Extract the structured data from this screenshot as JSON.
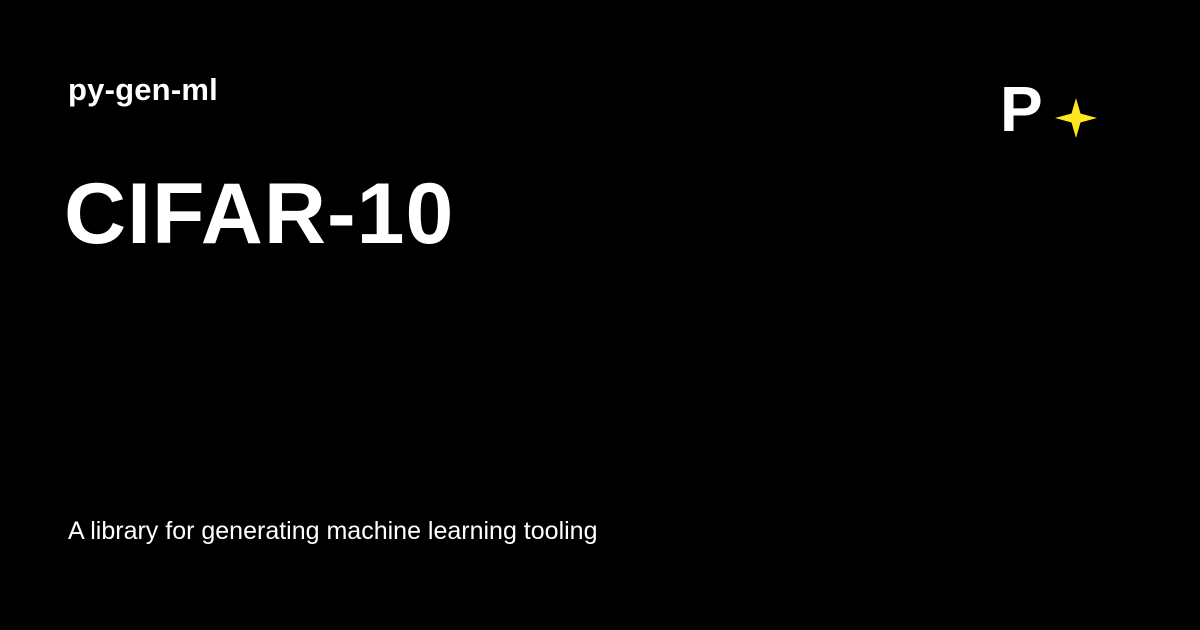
{
  "card": {
    "project_name": "py-gen-ml",
    "title": "CIFAR-10",
    "description": "A library for generating machine learning tooling",
    "logo": {
      "letter": "P",
      "icon": "sparkle-icon",
      "letter_color": "#ffffff",
      "sparkle_color": "#ffe51f"
    }
  }
}
